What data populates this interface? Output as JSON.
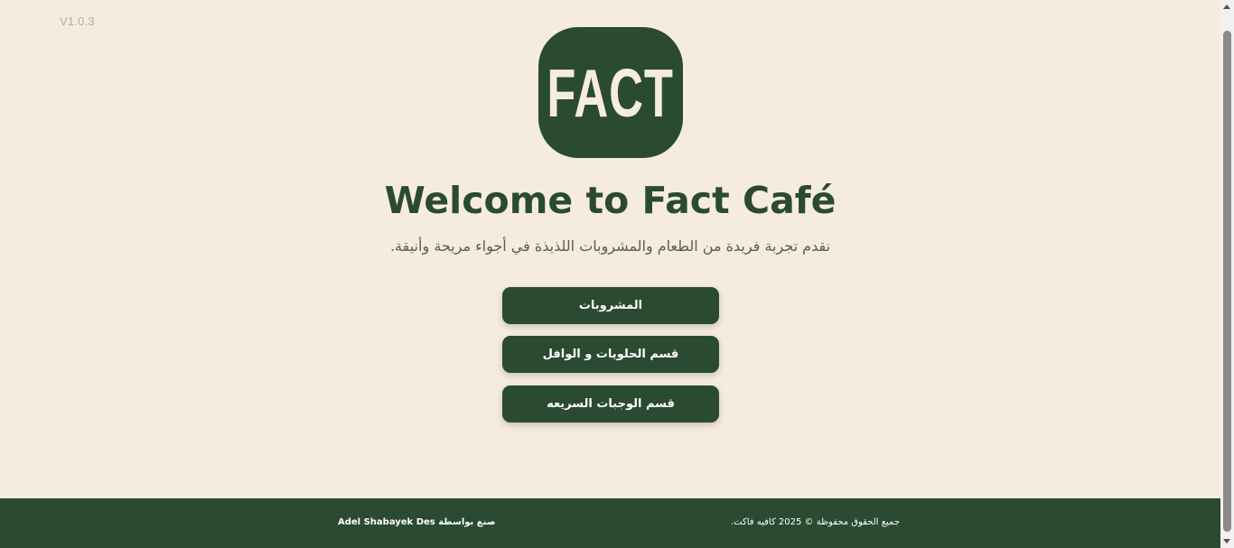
{
  "version": "V1.0.3",
  "logo": {
    "text": "FACT"
  },
  "hero": {
    "title": "Welcome to Fact Café",
    "subtitle": "نقدم تجربة فريدة من الطعام والمشروبات اللذيذة في أجواء مريحة وأنيقة."
  },
  "menu": {
    "buttons": [
      {
        "label": "المشروبات"
      },
      {
        "label": "قسم الحلويات و الوافل"
      },
      {
        "label": "قسم الوجبات السريعه"
      }
    ]
  },
  "footer": {
    "credit": "صنع بواسطة Adel Shabayek Des",
    "copyright": "جميع الحقوق محفوظة © 2025 كافيه فاكت."
  },
  "colors": {
    "background": "#f5ecdf",
    "primary": "#2a4a31",
    "text_muted": "#5d5a55",
    "version": "#b6aab8"
  }
}
